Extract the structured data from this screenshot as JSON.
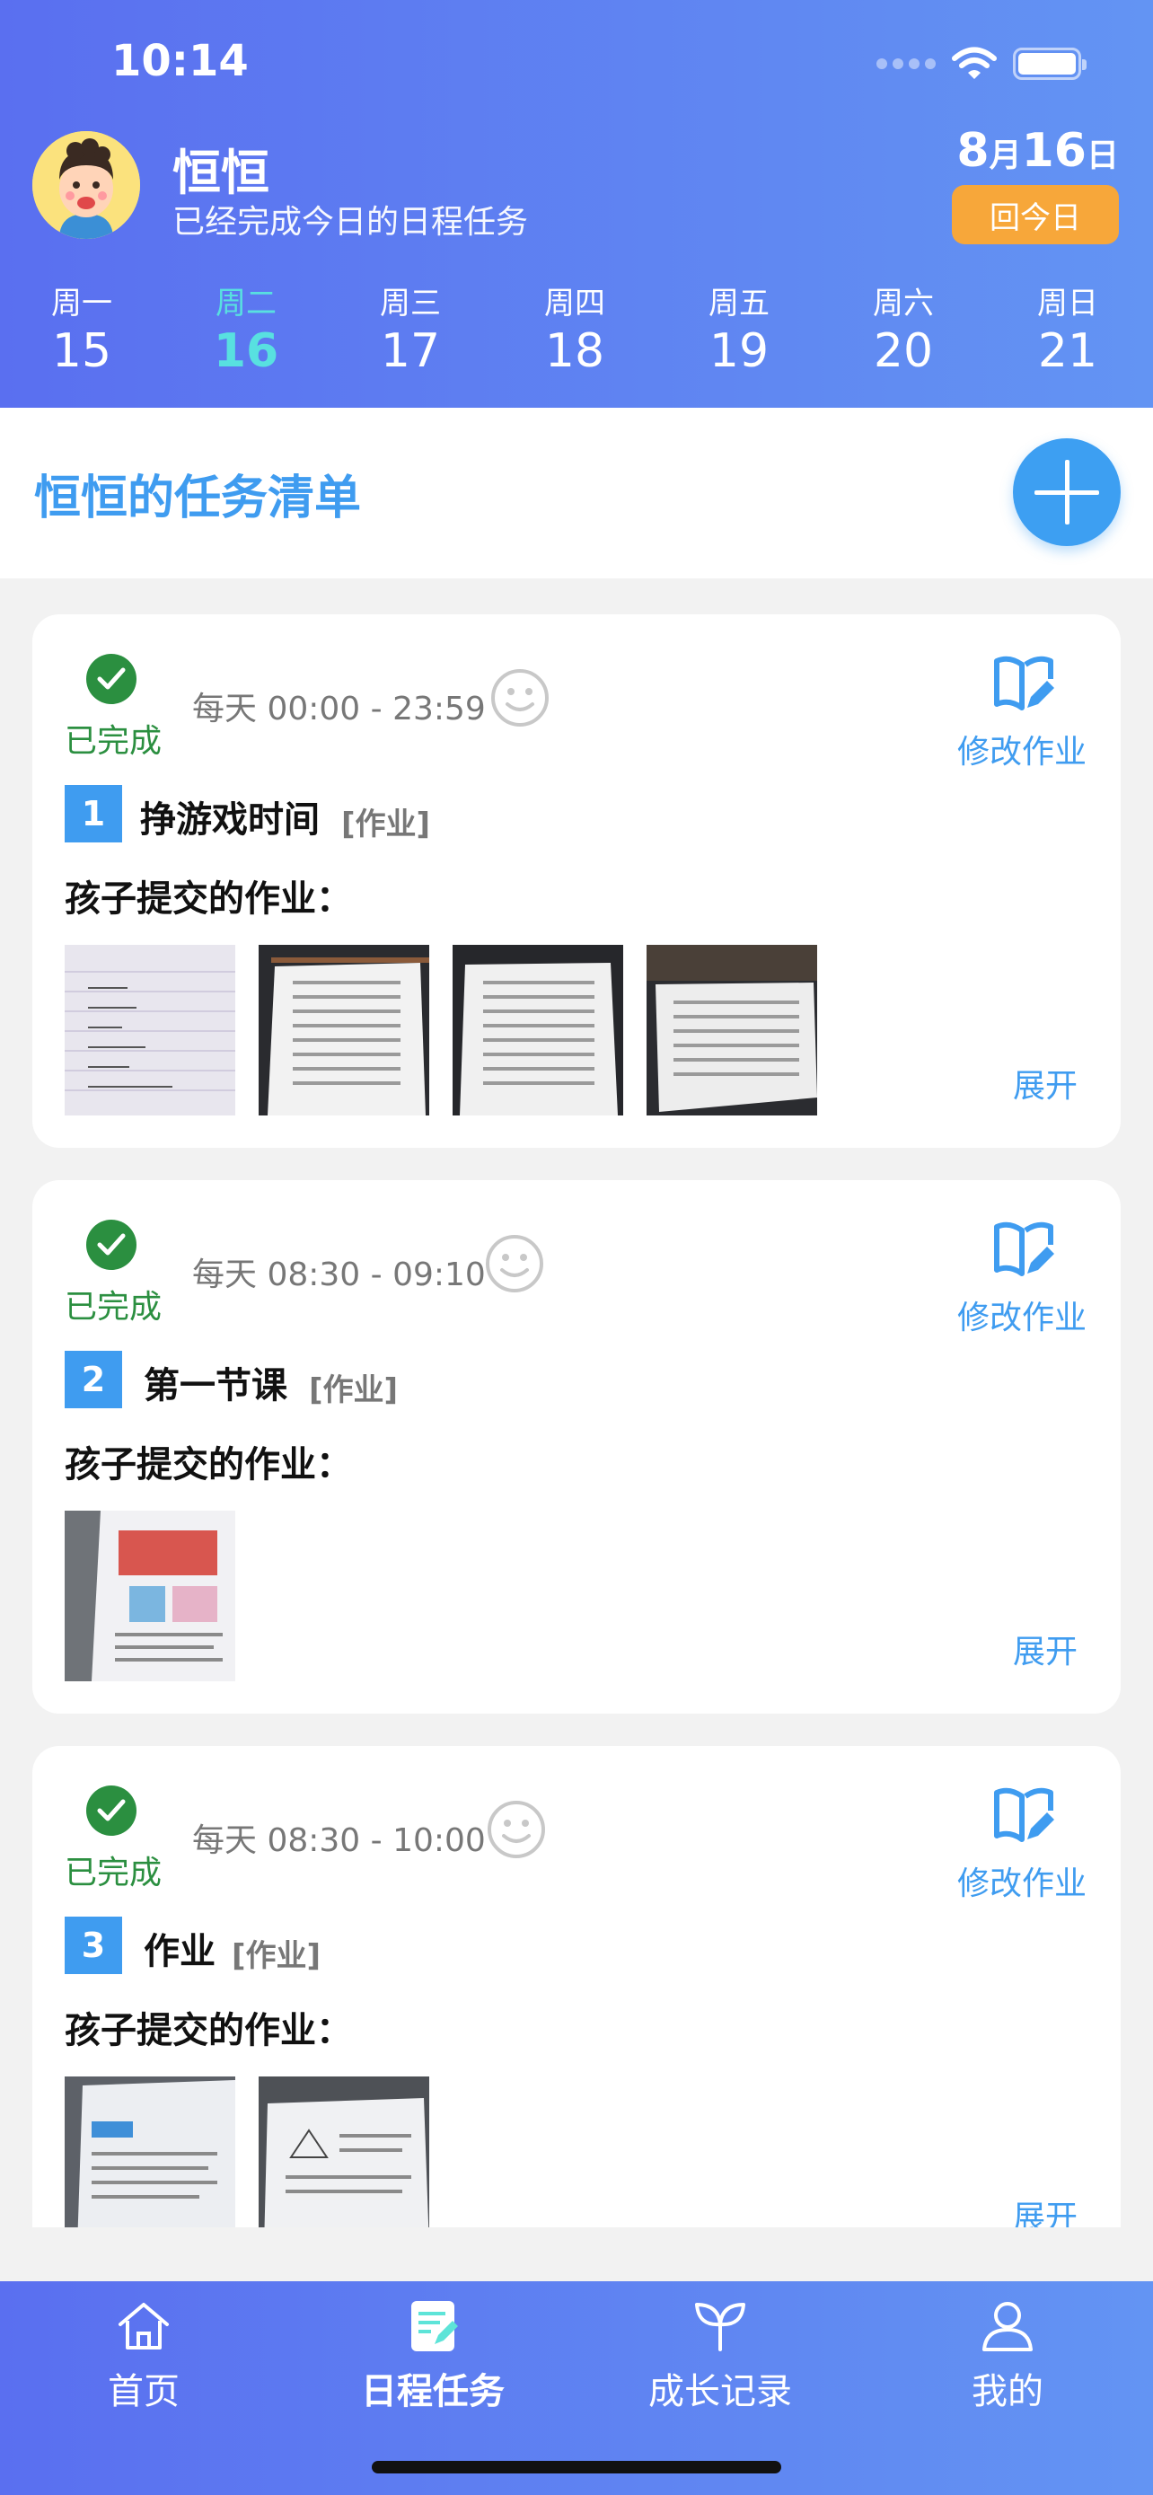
{
  "status_bar": {
    "time": "10:14"
  },
  "header": {
    "user_name": "恒恒",
    "user_status": "已经完成今日的日程任务",
    "date_month": "8",
    "date_month_unit": "月",
    "date_day": "16",
    "date_day_unit": "日",
    "today_button": "回今日"
  },
  "week": [
    {
      "weekday": "周一",
      "date": "15",
      "active": false
    },
    {
      "weekday": "周二",
      "date": "16",
      "active": true
    },
    {
      "weekday": "周三",
      "date": "17",
      "active": false
    },
    {
      "weekday": "周四",
      "date": "18",
      "active": false
    },
    {
      "weekday": "周五",
      "date": "19",
      "active": false
    },
    {
      "weekday": "周六",
      "date": "20",
      "active": false
    },
    {
      "weekday": "周日",
      "date": "21",
      "active": false
    }
  ],
  "task_list": {
    "title": "恒恒的任务清单",
    "tasks": [
      {
        "status": "已完成",
        "time": "每天 00:00 - 23:59",
        "edit_label": "修改作业",
        "number": "1",
        "name": "挣游戏时间",
        "tag": "[作业]",
        "submitted_label": "孩子提交的作业：",
        "expand_label": "展开"
      },
      {
        "status": "已完成",
        "time": "每天 08:30 - 09:10",
        "edit_label": "修改作业",
        "number": "2",
        "name": "第一节课",
        "tag": "[作业]",
        "submitted_label": "孩子提交的作业：",
        "expand_label": "展开"
      },
      {
        "status": "已完成",
        "time": "每天 08:30 - 10:00",
        "edit_label": "修改作业",
        "number": "3",
        "name": "作业",
        "tag": "[作业]",
        "submitted_label": "孩子提交的作业：",
        "expand_label": "展开"
      }
    ]
  },
  "tabbar": {
    "items": [
      {
        "label": "首页",
        "icon": "home-icon"
      },
      {
        "label": "日程任务",
        "icon": "schedule-icon",
        "active": true
      },
      {
        "label": "成长记录",
        "icon": "sprout-icon"
      },
      {
        "label": "我的",
        "icon": "profile-icon"
      }
    ]
  },
  "colors": {
    "header_start": "#5a6ff0",
    "header_end": "#6394f3",
    "accent": "#3f9cf0",
    "active_day": "#58e0e0",
    "done_green": "#2b8f40",
    "today_orange": "#f7a73a"
  }
}
